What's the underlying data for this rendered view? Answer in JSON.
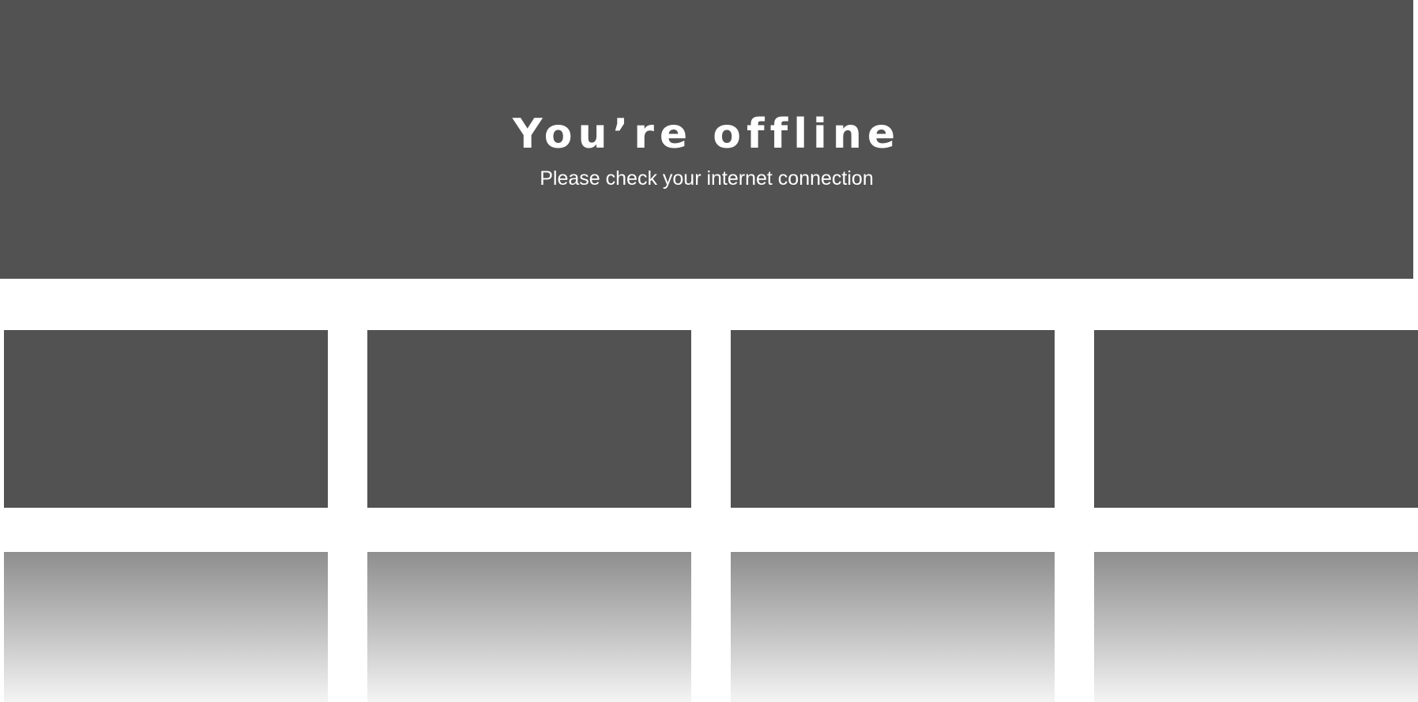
{
  "offline_banner": {
    "title": "You’re offline",
    "subtitle": "Please check your internet connection"
  },
  "colors": {
    "placeholder_dark": "#525252",
    "placeholder_fade_start": "#8e8e8e",
    "placeholder_fade_end": "#f4f4f4",
    "background": "#ffffff",
    "text": "#ffffff"
  }
}
